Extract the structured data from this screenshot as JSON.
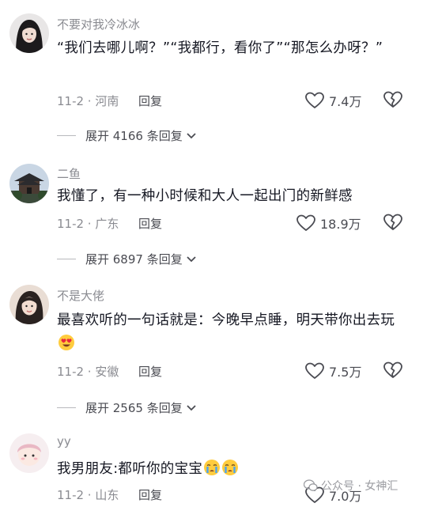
{
  "comments": [
    {
      "username": "不要对我冷冰冰",
      "text": "“我们去哪儿啊？”“我都行，看你了”“那怎么办呀？”",
      "meta": "11-2 · 河南",
      "reply_label": "回复",
      "likes": "7.4万",
      "expand": "展开 4166 条回复"
    },
    {
      "username": "二鱼",
      "text": "我懂了，有一种小时候和大人一起出门的新鲜感",
      "meta": "11-2 · 广东",
      "reply_label": "回复",
      "likes": "18.9万",
      "expand": "展开 6897 条回复"
    },
    {
      "username": "不是大佬",
      "text": "最喜欢听的一句话就是：今晚早点睡，明天带你出去玩",
      "meta": "11-2 · 安徽",
      "reply_label": "回复",
      "likes": "7.5万",
      "expand": "展开 2565 条回复"
    },
    {
      "username": "yy",
      "text": "我男朋友:都听你的宝宝",
      "meta": "11-2 · 山东",
      "reply_label": "回复",
      "likes": "7.0万"
    }
  ],
  "watermark": "公众号 · 女神汇",
  "icons": {
    "like": "heart-outline-icon",
    "dislike": "broken-heart-icon",
    "expand": "chevron-down-icon",
    "smile_emoji": "heart-eyes-emoji",
    "cry_emoji": "crying-emoji"
  }
}
